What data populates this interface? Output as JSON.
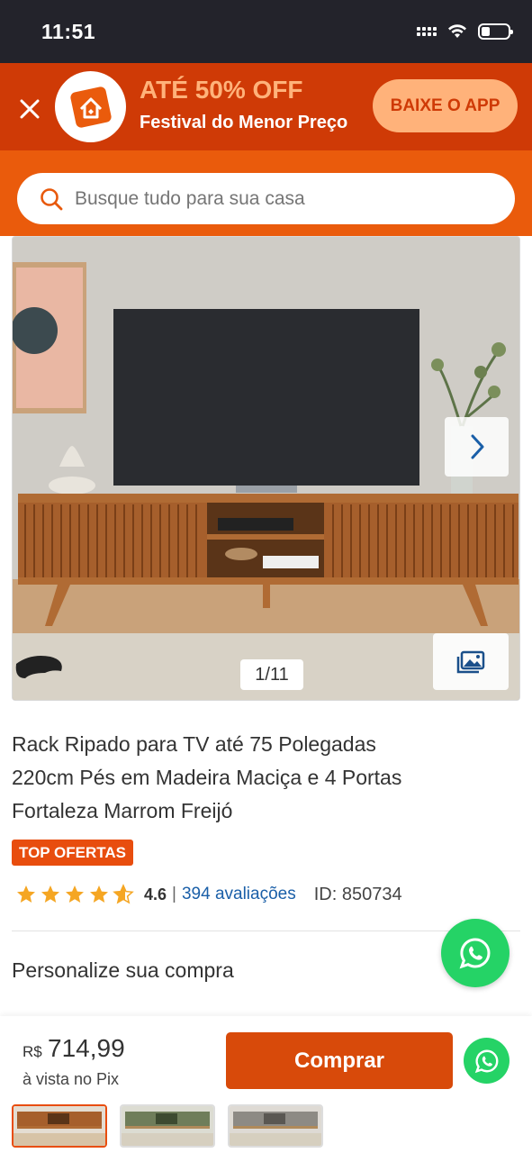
{
  "status": {
    "time": "11:51"
  },
  "promo": {
    "title": "ATÉ 50% OFF",
    "subtitle": "Festival do Menor Preço",
    "cta": "BAIXE O APP"
  },
  "search": {
    "placeholder": "Busque tudo para sua casa"
  },
  "gallery": {
    "counter": "1/11"
  },
  "product": {
    "title": "Rack Ripado para TV até 75 Polegadas 220cm Pés em Madeira Maciça e 4 Portas Fortaleza Marrom Freijó",
    "badge": "TOP OFERTAS",
    "rating": "4.6",
    "rating_fraction": 0.92,
    "separator": "|",
    "reviews": "394 avaliações",
    "id_label": "ID: 850734"
  },
  "personalize": {
    "heading": "Personalize sua compra"
  },
  "purchase": {
    "currency": "R$",
    "price": "714,99",
    "price_note": "à vista no Pix",
    "buy_label": "Comprar"
  },
  "colors": {
    "brand_dark": "#cf3a06",
    "brand": "#ea5b0c",
    "accent": "#ffb27a",
    "whatsapp": "#25d366",
    "link": "#1a5fa8"
  },
  "variants": [
    {
      "name": "Marrom Freijó",
      "selected": true
    },
    {
      "name": "Verde",
      "selected": false
    },
    {
      "name": "Cinza",
      "selected": false
    }
  ]
}
